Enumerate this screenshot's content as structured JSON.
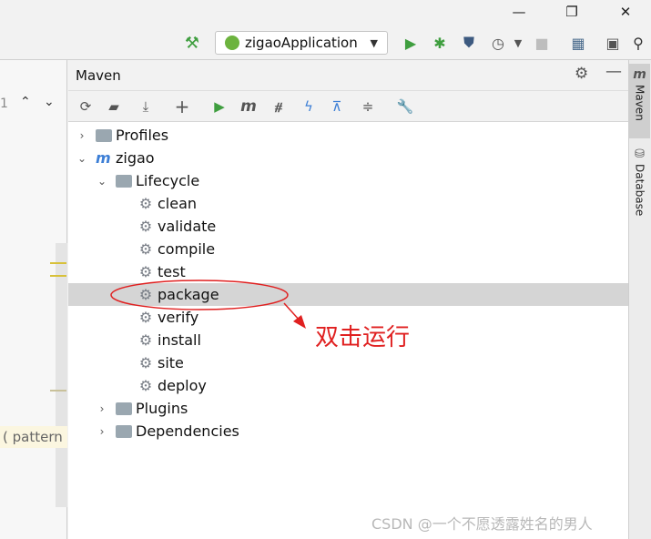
{
  "run_config": {
    "label": "zigaoApplication"
  },
  "maven_panel": {
    "title": "Maven"
  },
  "tree": {
    "profiles": "Profiles",
    "project": "zigao",
    "lifecycle": "Lifecycle",
    "goals": [
      "clean",
      "validate",
      "compile",
      "test",
      "package",
      "verify",
      "install",
      "site",
      "deploy"
    ],
    "plugins": "Plugins",
    "dependencies": "Dependencies"
  },
  "selected_goal": "package",
  "annotation": {
    "text": "双击运行",
    "color": "#e02020"
  },
  "side_tabs": {
    "maven": "Maven",
    "database": "Database"
  },
  "editor_fragments": {
    "line_hint": "1",
    "code": "( pattern"
  },
  "watermark": "CSDN @一个不愿透露姓名的男人",
  "colors": {
    "run_green": "#3f9e3f",
    "accent_blue": "#3d7fd6",
    "selection": "#d5d5d5"
  }
}
